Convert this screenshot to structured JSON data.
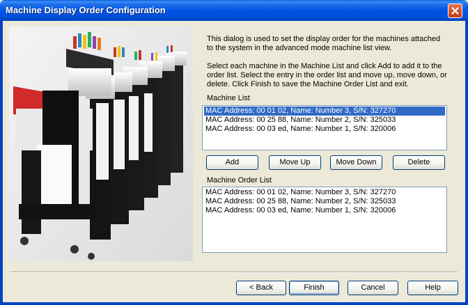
{
  "window": {
    "title": "Machine Display Order Configuration"
  },
  "instructions": {
    "paragraph1": "This dialog is used to set the display order for the machines attached to the system in the advanced mode machine list view.",
    "paragraph2": "Select each machine in the Machine List and click Add to add it to the order list. Select the entry in the order list and move up, move down, or delete. Click Finish to save the Machine Order List and exit."
  },
  "machine_list": {
    "label": "Machine List",
    "items": [
      "MAC Address: 00 01 02, Name: Number 3, S/N: 327270",
      "MAC Address: 00 25 88, Name: Number 2, S/N: 325033",
      "MAC Address: 00 03 ed, Name: Number 1, S/N: 320006"
    ],
    "selected_index": 0
  },
  "list_buttons": {
    "add": "Add",
    "move_up": "Move Up",
    "move_down": "Move Down",
    "delete": "Delete"
  },
  "order_list": {
    "label": "Machine Order List",
    "items": [
      "MAC Address: 00 01 02, Name: Number 3, S/N: 327270",
      "MAC Address: 00 25 88, Name: Number 2, S/N: 325033",
      "MAC Address: 00 03 ed, Name: Number 1, S/N: 320006"
    ]
  },
  "footer_buttons": {
    "back": "< Back",
    "finish": "Finish",
    "cancel": "Cancel",
    "help": "Help"
  },
  "icons": {
    "close": "close-icon",
    "illustration": "embroidery-machines-illustration"
  },
  "colors": {
    "titlebar": "#0055E5",
    "selection": "#316AC5",
    "dialog_bg": "#ECE9D8"
  }
}
